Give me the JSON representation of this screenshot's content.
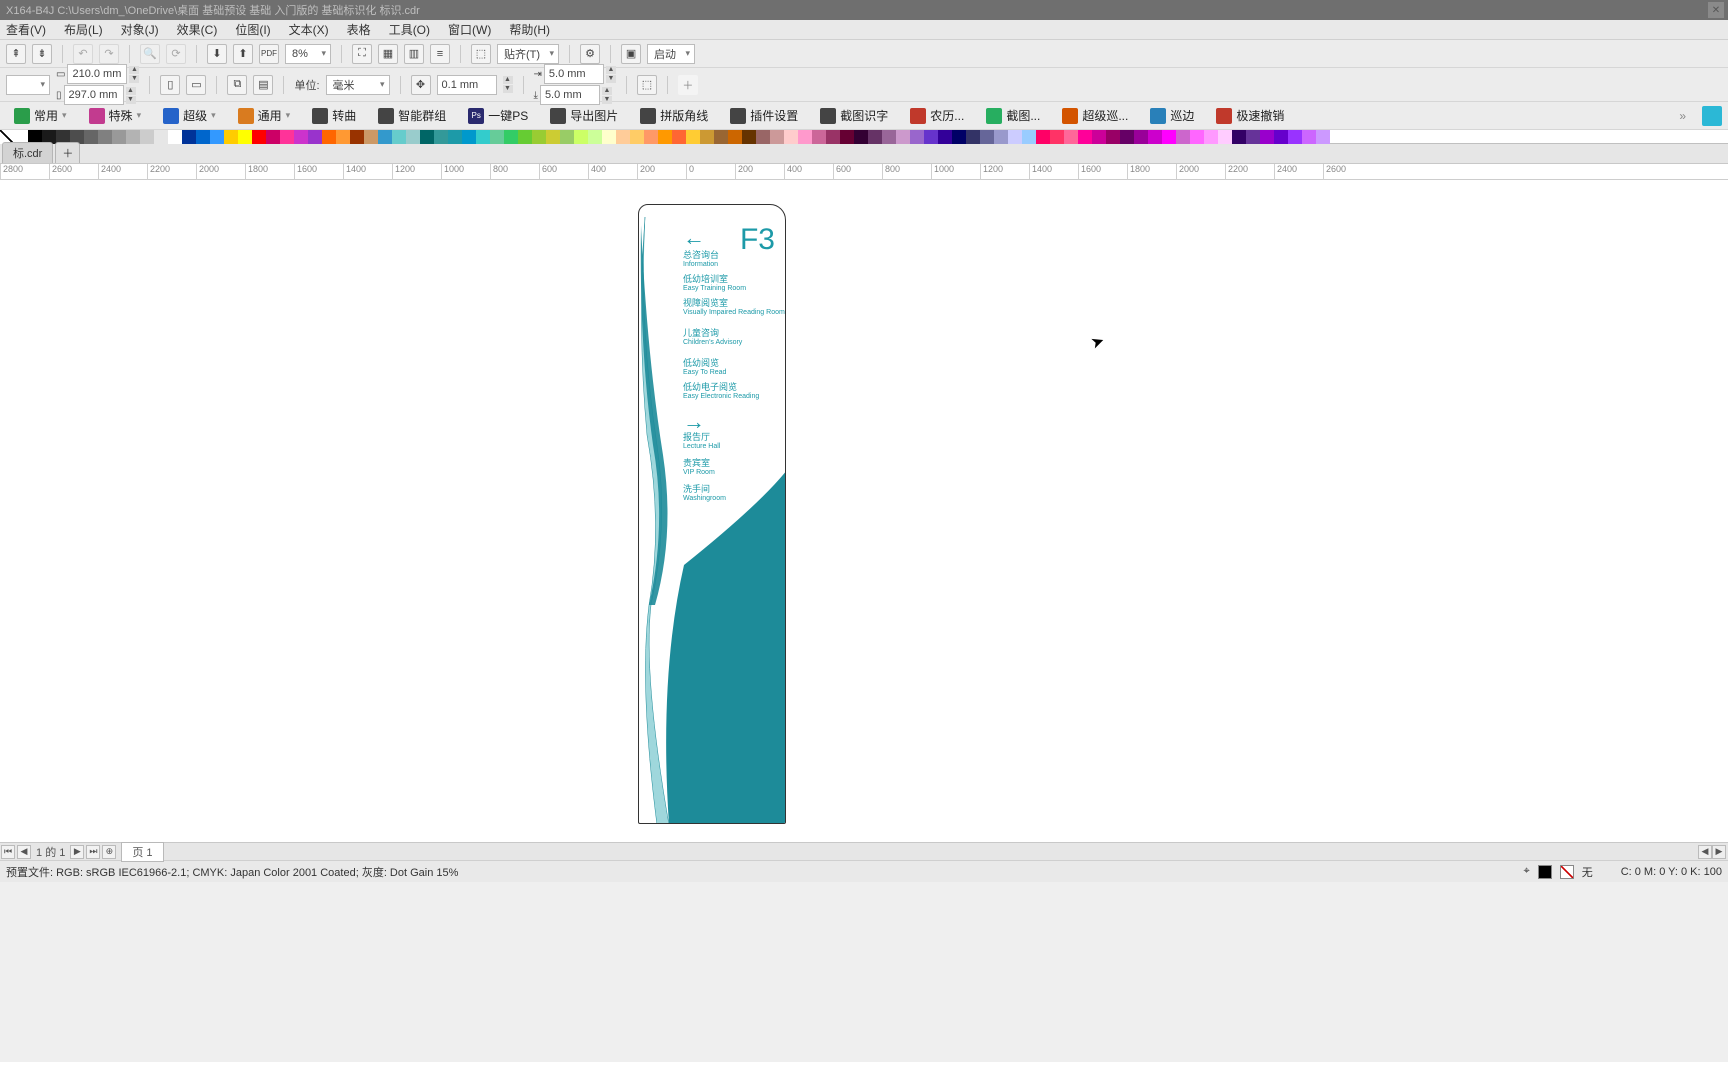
{
  "titlebar": {
    "path": "X164-B4J   C:\\Users\\dm_\\OneDrive\\桌面 基础预设 基础 入门版的 基础标识化 标识.cdr"
  },
  "menu": {
    "view": "查看(V)",
    "layout": "布局(L)",
    "object": "对象(J)",
    "effect": "效果(C)",
    "bitmap": "位图(I)",
    "text": "文本(X)",
    "table": "表格",
    "tool": "工具(O)",
    "window": "窗口(W)",
    "help": "帮助(H)"
  },
  "tb1": {
    "zoom": "8%",
    "paste": "贴齐(T)",
    "launch": "启动"
  },
  "tb2": {
    "w": "210.0 mm",
    "h": "297.0 mm",
    "unitLabel": "单位:",
    "unit": "毫米",
    "nudge": "0.1 mm",
    "dup1": "5.0 mm",
    "dup2": "5.0 mm"
  },
  "tb3": {
    "common": "常用",
    "special": "特殊",
    "super": "超级",
    "general": "通用",
    "curve": "转曲",
    "smartgroup": "智能群组",
    "ps": "一键PS",
    "export": "导出图片",
    "spell": "拼版角线",
    "plugin": "插件设置",
    "ocr": "截图识字",
    "cal": "农历...",
    "sshot": "截图...",
    "patrol": "超级巡...",
    "patrol2": "巡边",
    "undo": "极速撤销"
  },
  "filetab": "标.cdr",
  "ruler": [
    "-2800",
    "-2600",
    "-2400",
    "-2200",
    "-2000",
    "-1800",
    "-1600",
    "-1400",
    "-1200",
    "-1000",
    "-800",
    "-600",
    "-400",
    "-200",
    "0",
    "200",
    "400",
    "600",
    "800",
    "1000",
    "1200",
    "1400",
    "1600",
    "1800",
    "2000",
    "2200",
    "2400",
    "2600"
  ],
  "sign": {
    "floor": "F3",
    "left": [
      {
        "cn": "总咨询台",
        "en": "Information"
      },
      {
        "cn": "低幼培训室",
        "en": "Easy Training Room"
      },
      {
        "cn": "视障阅览室",
        "en": "Visually Impaired Reading Room"
      },
      {
        "cn": "儿童咨询",
        "en": "Children's Advisory"
      },
      {
        "cn": "低幼阅览",
        "en": "Easy To Read"
      },
      {
        "cn": "低幼电子阅览",
        "en": "Easy Electronic Reading"
      }
    ],
    "right": [
      {
        "cn": "报告厅",
        "en": "Lecture Hall"
      },
      {
        "cn": "贵宾室",
        "en": "VIP Room"
      },
      {
        "cn": "洗手间",
        "en": "Washingroom"
      }
    ]
  },
  "pagebar": {
    "of": "的",
    "page": "页 1",
    "cur": "1",
    "total": "1"
  },
  "status": {
    "profile": "预置文件: RGB: sRGB IEC61966-2.1; CMYK: Japan Color 2001 Coated; 灰度: Dot Gain 15%",
    "fill": "无",
    "cmyk": "C:  0 M:  0 Y:  0 K:  100"
  },
  "palette": [
    "#ffffff",
    "#000000",
    "#1a1a1a",
    "#333333",
    "#4d4d4d",
    "#666666",
    "#808080",
    "#999999",
    "#b3b3b3",
    "#cccccc",
    "#e6e6e6",
    "#ffffff",
    "#003399",
    "#0066cc",
    "#3399ff",
    "#ffcc00",
    "#ffff00",
    "#ff0000",
    "#cc0066",
    "#ff3399",
    "#cc33cc",
    "#9933cc",
    "#ff6600",
    "#ff9933",
    "#993300",
    "#cc9966",
    "#3399cc",
    "#66cccc",
    "#99cccc",
    "#006666",
    "#339999",
    "#1d9aa8",
    "#0099cc",
    "#33cccc",
    "#66cc99",
    "#33cc66",
    "#66cc33",
    "#99cc33",
    "#cccc33",
    "#99cc66",
    "#ccff66",
    "#ccff99",
    "#ffffcc",
    "#ffcc99",
    "#ffcc66",
    "#ff9966",
    "#ff9900",
    "#ff6633",
    "#ffcc33",
    "#cc9933",
    "#996633",
    "#cc6600",
    "#663300",
    "#996666",
    "#cc9999",
    "#ffcccc",
    "#ff99cc",
    "#cc6699",
    "#993366",
    "#660033",
    "#330033",
    "#663366",
    "#996699",
    "#cc99cc",
    "#9966cc",
    "#6633cc",
    "#330099",
    "#000066",
    "#333366",
    "#666699",
    "#9999cc",
    "#ccccff",
    "#99ccff",
    "#ff0066",
    "#ff3366",
    "#ff6699",
    "#ff0099",
    "#cc0099",
    "#990066",
    "#660066",
    "#990099",
    "#cc00cc",
    "#ff00ff",
    "#cc66cc",
    "#ff66ff",
    "#ff99ff",
    "#ffccff",
    "#330066",
    "#663399",
    "#9900cc",
    "#6600cc",
    "#9933ff",
    "#cc66ff",
    "#cc99ff"
  ]
}
